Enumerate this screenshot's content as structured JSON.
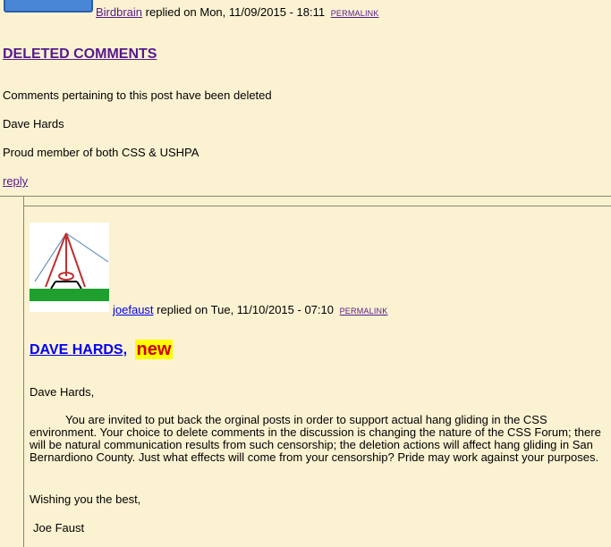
{
  "comment1": {
    "author": "Birdbrain",
    "replied_text": "replied on Mon, 11/09/2015 - 18:11",
    "permalink": "PERMALINK",
    "title": "DELETED COMMENTS",
    "body": "Comments pertaining to this post have been deleted",
    "signature_name": "Dave Hards",
    "signature_line": "Proud member of both CSS & USHPA",
    "reply": "reply"
  },
  "comment2": {
    "author": "joefaust",
    "replied_text": "replied on Tue, 11/10/2015 - 07:10",
    "permalink": "PERMALINK",
    "title": "DAVE HARDS,",
    "new_badge": "new",
    "greeting": "Dave Hards,",
    "body": "You are invited to put back the orginal posts in order to support actual hang gliding in the CSS environment.  Your choice to delete comments in the discussion is changing the nature of the CSS Forum; there will be natural communication results from such censorship; the deletion actions will affect hang gliding in San Bernardiono County.  Just what effects will come from your censorship?  Pride may work against your purposes.",
    "closing": "Wishing you the best,",
    "signature": "Joe Faust"
  },
  "colors": {
    "background": "#fbf2d2",
    "visited_link": "#551a8b",
    "link": "#0000ee",
    "new_badge_bg": "#ffff00",
    "new_badge_text": "#cc0000"
  }
}
